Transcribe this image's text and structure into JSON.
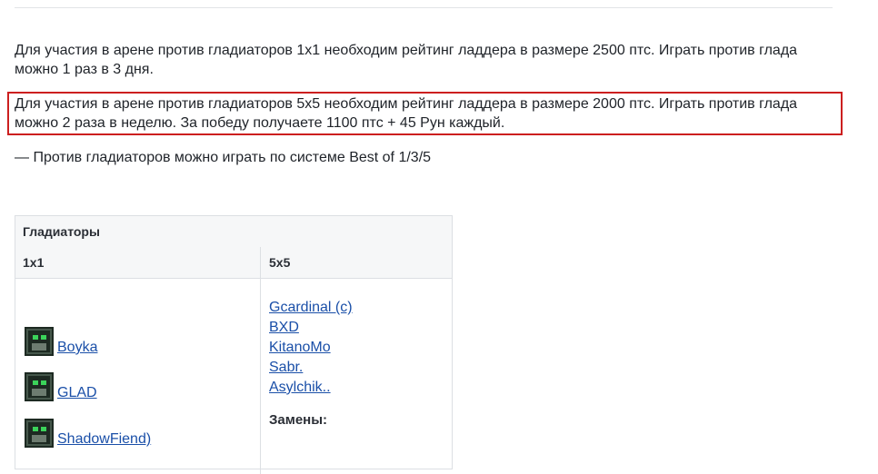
{
  "paragraphs": [
    "Для участия в арене против гладиаторов 1х1 необходим рейтинг ладдера в размере 2500 птс. Играть против глада можно 1 раз в 3 дня.",
    "Для участия в арене против гладиаторов 5х5 необходим рейтинг ладдера в размере 2000 птс. Играть против глада можно 2 раза в неделю. За победу получаете 1100 птс + 45 Рун каждый.",
    "— Против гладиаторов можно играть по системе Best of 1/3/5"
  ],
  "highlight_color": "#cc1f1f",
  "table": {
    "title": "Гладиаторы",
    "columns": [
      "1х1",
      "5х5"
    ],
    "gladiators_1x1": [
      "Boyka",
      "GLAD",
      "ShadowFiend)"
    ],
    "gladiators_5x5": [
      "Gcardinal (c)",
      "BXD",
      "KitanoMo",
      "Sabr.",
      "Asylchik.."
    ],
    "substitutes_label": "Замены:"
  },
  "link_color": "#1a4fa8"
}
